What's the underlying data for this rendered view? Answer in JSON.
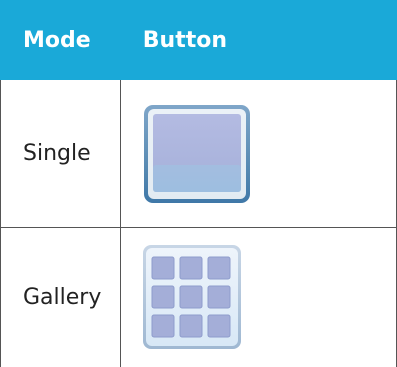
{
  "table": {
    "headers": [
      "Mode",
      "Button"
    ],
    "rows": [
      {
        "mode": "Single",
        "button_icon": "single-view-icon"
      },
      {
        "mode": "Gallery",
        "button_icon": "gallery-view-icon"
      }
    ]
  },
  "colors": {
    "header_bg": "#1aa9d8",
    "header_text": "#ffffff",
    "border": "#555555",
    "icon_fill": "#a9b3dc",
    "icon_frame": "#5a8cb4"
  }
}
